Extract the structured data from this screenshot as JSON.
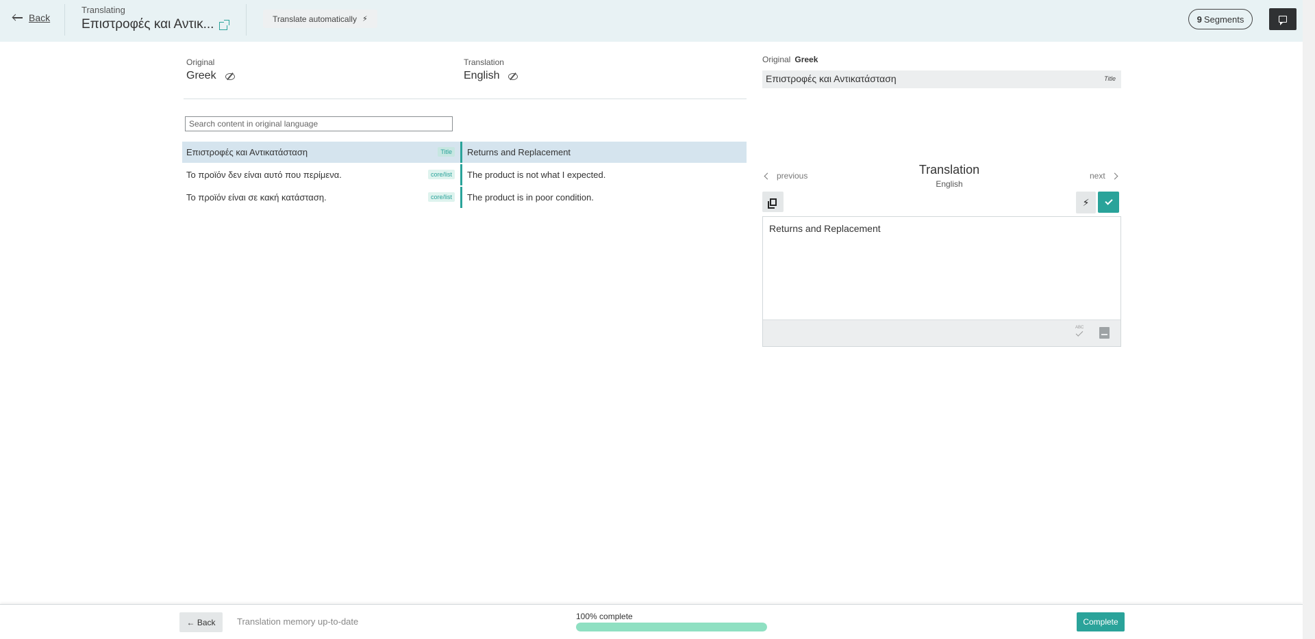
{
  "header": {
    "back_label": "Back",
    "kicker": "Translating",
    "title": "Επιστροφές και Αντικ...",
    "translate_auto_label": "Translate automatically",
    "segments_count": "9",
    "segments_label": "Segments"
  },
  "languages": {
    "original_kicker": "Original",
    "original_name": "Greek",
    "translation_kicker": "Translation",
    "translation_name": "English"
  },
  "search": {
    "placeholder": "Search content in original language"
  },
  "segments": [
    {
      "original": "Επιστροφές και Αντικατάσταση",
      "tag": "Title",
      "translation": "Returns and Replacement",
      "active": true
    },
    {
      "original": "Το προϊόν δεν είναι αυτό που περίμενα.",
      "tag": "core/list",
      "translation": "The product is not what I expected.",
      "active": false
    },
    {
      "original": "Το προϊόν είναι σε κακή κατάσταση.",
      "tag": "core/list",
      "translation": "The product is in poor condition.",
      "active": false
    }
  ],
  "panel": {
    "original_label": "Original",
    "original_lang": "Greek",
    "original_text": "Επιστροφές και Αντικατάσταση",
    "original_tag": "Title",
    "prev_label": "previous",
    "next_label": "next",
    "heading": "Translation",
    "sub": "English",
    "editor_text": "Returns and Replacement",
    "spell_abc": "ABC"
  },
  "footer": {
    "back_label": "← Back",
    "status": "Translation memory up-to-date",
    "progress_label": "100% complete",
    "progress_fraction": 1.0,
    "complete_label": "Complete"
  },
  "colors": {
    "accent": "#2aa39a",
    "header_bg": "#e8f2f4",
    "active_row": "#d5e4ee",
    "progress_fill": "#8fe0c2"
  },
  "icons": [
    "arrow-left-icon",
    "external-link-icon",
    "bolt-icon",
    "chat-icon",
    "eye-off-icon",
    "chevron-left-icon",
    "chevron-right-icon",
    "copy-icon",
    "check-icon",
    "spellcheck-icon",
    "book-icon"
  ]
}
